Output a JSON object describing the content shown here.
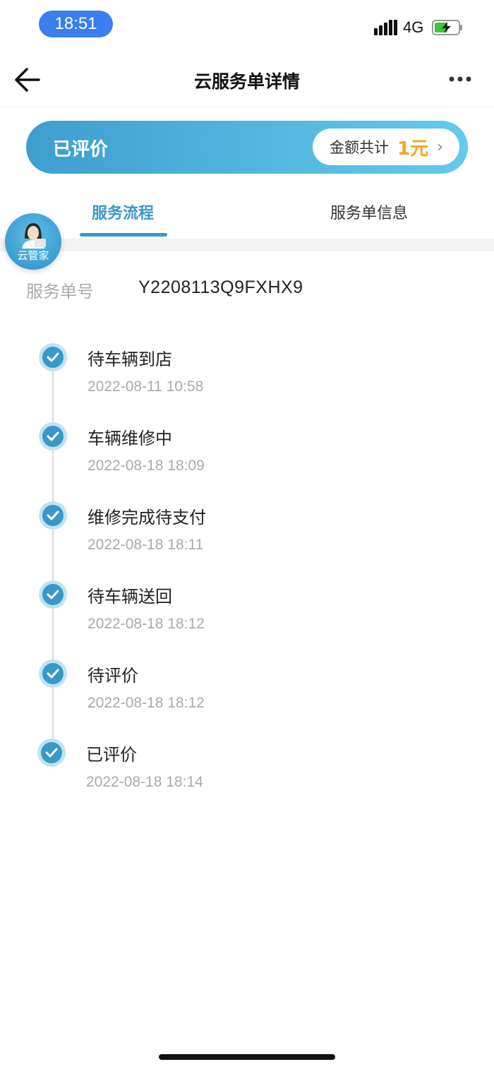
{
  "status_bar": {
    "time": "18:51",
    "network": "4G"
  },
  "nav": {
    "title": "云服务单详情"
  },
  "banner": {
    "status": "已评价",
    "amount_label": "金额共计",
    "amount_value": "1元"
  },
  "tabs": [
    {
      "label": "服务流程",
      "active": true
    },
    {
      "label": "服务单信息",
      "active": false
    }
  ],
  "assistant": {
    "label": "云管家"
  },
  "order": {
    "label": "服务单号",
    "value": "Y2208113Q9FXHX9"
  },
  "steps": [
    {
      "title": "待车辆到店",
      "time": "2022-08-11 10:58"
    },
    {
      "title": "车辆维修中",
      "time": "2022-08-18 18:09"
    },
    {
      "title": "维修完成待支付",
      "time": "2022-08-18 18:11"
    },
    {
      "title": "待车辆送回",
      "time": "2022-08-18 18:12"
    },
    {
      "title": "待评价",
      "time": "2022-08-18 18:12"
    },
    {
      "title": "已评价",
      "time": "2022-08-18 18:14"
    }
  ],
  "colors": {
    "accent": "#3a98c9",
    "amount": "#f5a623",
    "time_pill": "#3a7ef0"
  }
}
